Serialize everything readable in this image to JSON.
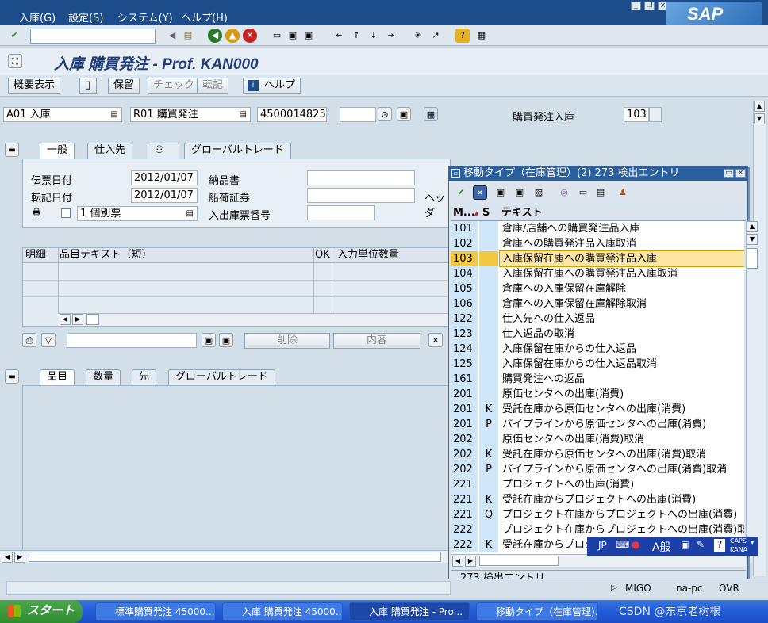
{
  "menu": [
    "入庫(G)",
    "設定(S)",
    "システム(Y)",
    "ヘルプ(H)"
  ],
  "brand": "SAP",
  "command_field": "",
  "title": "入庫 購買発注 - Prof. KAN000",
  "appbar": {
    "overview": "概要表示",
    "save": "保留",
    "check": "チェック",
    "post": "転記",
    "help": "ヘルプ"
  },
  "header": {
    "action": "A01 入庫",
    "ref_doc": "R01 購買発注",
    "po_number": "4500014825",
    "extra": "",
    "movement_label": "購買発注入庫",
    "movement_type": "103"
  },
  "header_tabs": [
    "一般",
    "仕入先",
    "",
    "グローバルトレード"
  ],
  "general": {
    "doc_date_label": "伝票日付",
    "doc_date": "2012/01/07",
    "post_date_label": "転記日付",
    "post_date": "2012/01/07",
    "delivery_note_label": "納品書",
    "bill_of_lading_label": "船荷証券",
    "gr_gi_slip_label": "入出庫票番号",
    "slip_option": "1 個別票",
    "header_text_label": "ヘッダ"
  },
  "items_grid": {
    "columns": [
      "明細",
      "品目テキスト（短）",
      "OK",
      "入力単位数量"
    ],
    "buttons": {
      "delete": "削除",
      "contents": "内容"
    }
  },
  "detail_tabs": [
    "品目",
    "数量",
    "先",
    "グローバルトレード"
  ],
  "popup": {
    "title": "移動タイプ（在庫管理）(2)  273 検出エントリ",
    "columns": [
      "M...",
      "S",
      "テキスト"
    ],
    "footer": "273 検出エントリ",
    "rows": [
      {
        "code": "101",
        "s": "",
        "text": "倉庫/店舗への購買発注品入庫"
      },
      {
        "code": "102",
        "s": "",
        "text": "倉庫への購買発注品入庫取消"
      },
      {
        "code": "103",
        "s": "",
        "text": "入庫保留在庫への購買発注品入庫"
      },
      {
        "code": "104",
        "s": "",
        "text": "入庫保留在庫への購買発注品入庫取消"
      },
      {
        "code": "105",
        "s": "",
        "text": "倉庫への入庫保留在庫解除"
      },
      {
        "code": "106",
        "s": "",
        "text": "倉庫への入庫保留在庫解除取消"
      },
      {
        "code": "122",
        "s": "",
        "text": "仕入先への仕入返品"
      },
      {
        "code": "123",
        "s": "",
        "text": "仕入返品の取消"
      },
      {
        "code": "124",
        "s": "",
        "text": "入庫保留在庫からの仕入返品"
      },
      {
        "code": "125",
        "s": "",
        "text": "入庫保留在庫からの仕入返品取消"
      },
      {
        "code": "161",
        "s": "",
        "text": "購買発注への返品"
      },
      {
        "code": "201",
        "s": "",
        "text": "原価センタへの出庫(消費)"
      },
      {
        "code": "201",
        "s": "K",
        "text": "受託在庫から原価センタへの出庫(消費)"
      },
      {
        "code": "201",
        "s": "P",
        "text": "パイプラインから原価センタへの出庫(消費)"
      },
      {
        "code": "202",
        "s": "",
        "text": "原価センタへの出庫(消費)取消"
      },
      {
        "code": "202",
        "s": "K",
        "text": "受託在庫から原価センタへの出庫(消費)取消"
      },
      {
        "code": "202",
        "s": "P",
        "text": "パイプラインから原価センタへの出庫(消費)取消"
      },
      {
        "code": "221",
        "s": "",
        "text": "プロジェクトへの出庫(消費)"
      },
      {
        "code": "221",
        "s": "K",
        "text": "受託在庫からプロジェクトへの出庫(消費)"
      },
      {
        "code": "221",
        "s": "Q",
        "text": "プロジェクト在庫からプロジェクトへの出庫(消費)"
      },
      {
        "code": "222",
        "s": "",
        "text": "プロジェクト在庫からプロジェクトへの出庫(消費)取消"
      },
      {
        "code": "222",
        "s": "K",
        "text": "受託在庫からプロジ"
      }
    ],
    "selected_index": 2
  },
  "ime": {
    "lang": "JP",
    "mode": "A般",
    "caps": "CAPS",
    "kana": "KANA"
  },
  "status": {
    "tcode": "MIGO",
    "server": "na-pc",
    "mode": "OVR"
  },
  "taskbar": {
    "start": "スタート",
    "tasks": [
      "標準購買発注 45000...",
      "入庫 購買発注 45000...",
      "入庫 購買発注 - Pro...",
      "移動タイプ（在庫管理)..."
    ]
  },
  "watermark": "CSDN @东京老树根"
}
